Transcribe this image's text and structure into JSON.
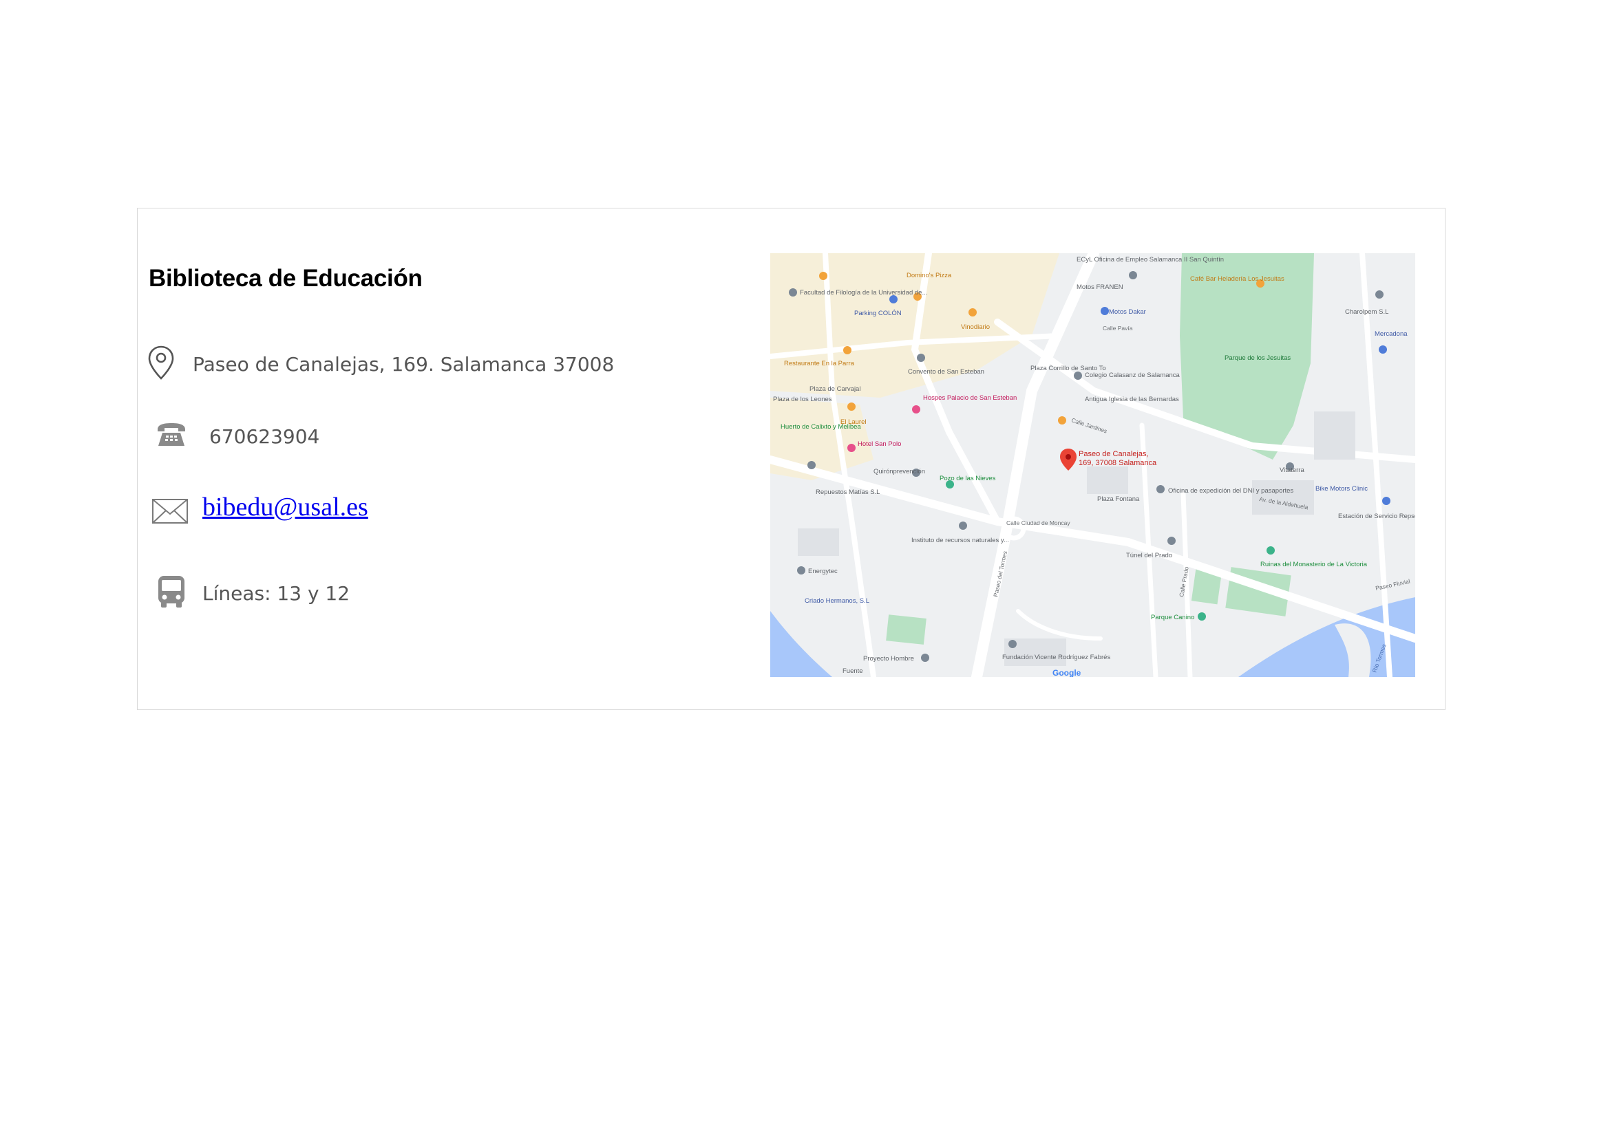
{
  "card": {
    "title": "Biblioteca de Educación",
    "address": "Paseo de Canalejas, 169. Salamanca 37008",
    "phone": "670623904",
    "email": "bibedu@usal.es",
    "bus": "Líneas: 13 y 12"
  },
  "icons": {
    "address": "location-pin-icon",
    "phone": "telephone-icon",
    "email": "envelope-icon",
    "bus": "bus-icon"
  },
  "map": {
    "pin_label_line1": "Paseo de Canalejas,",
    "pin_label_line2": "169, 37008 Salamanca",
    "places": [
      "Facultad de Filología de la Universidad de...",
      "Domino's Pizza",
      "Parking COLÓN",
      "Vinodiario",
      "Restaurante En la Parra",
      "Convento de San Esteban",
      "Plaza Corrillo de Santo To",
      "Colegio Calasanz de Salamanca",
      "Antigua Iglesia de las Bernardas",
      "Plaza de Carvajal",
      "Plaza de los Leones",
      "Huerto de Calixto y Melibea",
      "El Laurel",
      "Hospes Palacio de San Esteban",
      "Hotel San Polo",
      "Quirónprevención",
      "Pozo de las Nieves",
      "Repuestos Matías S.L",
      "Oficina de expedición del DNI y pasaportes",
      "Plaza Fontana",
      "Instituto de recursos naturales y...",
      "Túnel del Prado",
      "Energytec",
      "Criado Hermanos, S.L",
      "Ruinas del Monasterio de La Victoria",
      "Parque Canino",
      "Proyecto Hombre",
      "Fundación Vicente Rodríguez Fabrés",
      "Parque de los Jesuitas",
      "Café Bar Heladería Los Jesuitas",
      "ECyL Oficina de Empleo Salamanca II San Quintín",
      "Motos FRANEN",
      "Motos Dakar",
      "Charolpem S.L",
      "Mercadona",
      "Vitaterra",
      "Bike Motors Clinic",
      "Estación de Servicio Repsol",
      "Fuente",
      "Calle Pavía",
      "Calle Jardines",
      "Calle Ciudad de Moncay",
      "Av. de la Aldehuela",
      "Calle Prado",
      "Paseo del Tormes",
      "Paseo Fluvial",
      "Río Tormes",
      "Google"
    ],
    "colors": {
      "water": "#a8c7fa",
      "park": "#b7e1c3",
      "pin": "#ea4335"
    }
  }
}
